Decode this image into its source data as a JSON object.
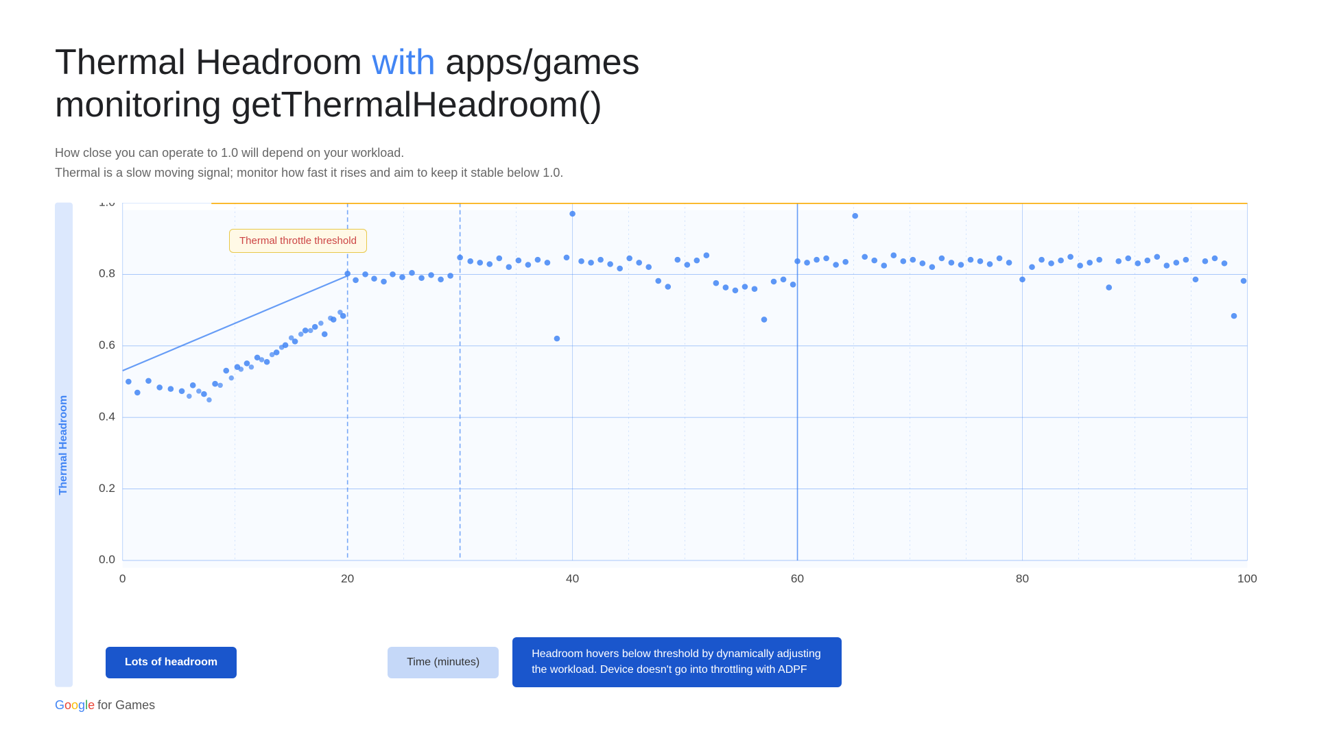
{
  "title": {
    "part1": "Thermal Headroom ",
    "highlight": "with",
    "part2": " apps/games",
    "line2": "monitoring getThermalHeadroom()"
  },
  "subtitle": {
    "line1": "How close you can operate to 1.0 will depend on your workload.",
    "line2": "Thermal is a slow moving signal; monitor how fast it rises and aim to keep it stable below 1.0."
  },
  "yaxis": {
    "label": "Thermal Headroom",
    "ticks": [
      "0.0",
      "0.2",
      "0.4",
      "0.6",
      "0.8",
      "1.0"
    ]
  },
  "xaxis": {
    "label": "Time (minutes)",
    "ticks": [
      "0",
      "20",
      "40",
      "60",
      "80",
      "100"
    ]
  },
  "chart": {
    "threshold_label": "Thermal throttle threshold",
    "threshold_y": 1.0
  },
  "annotations": {
    "lots_of_headroom": "Lots of headroom",
    "time_label": "Time (minutes)",
    "headroom_desc": "Headroom hovers below threshold by dynamically adjusting the workload. Device doesn't go into throttling with ADPF"
  },
  "google_logo": {
    "google": "Google",
    "for_games": " for Games"
  }
}
